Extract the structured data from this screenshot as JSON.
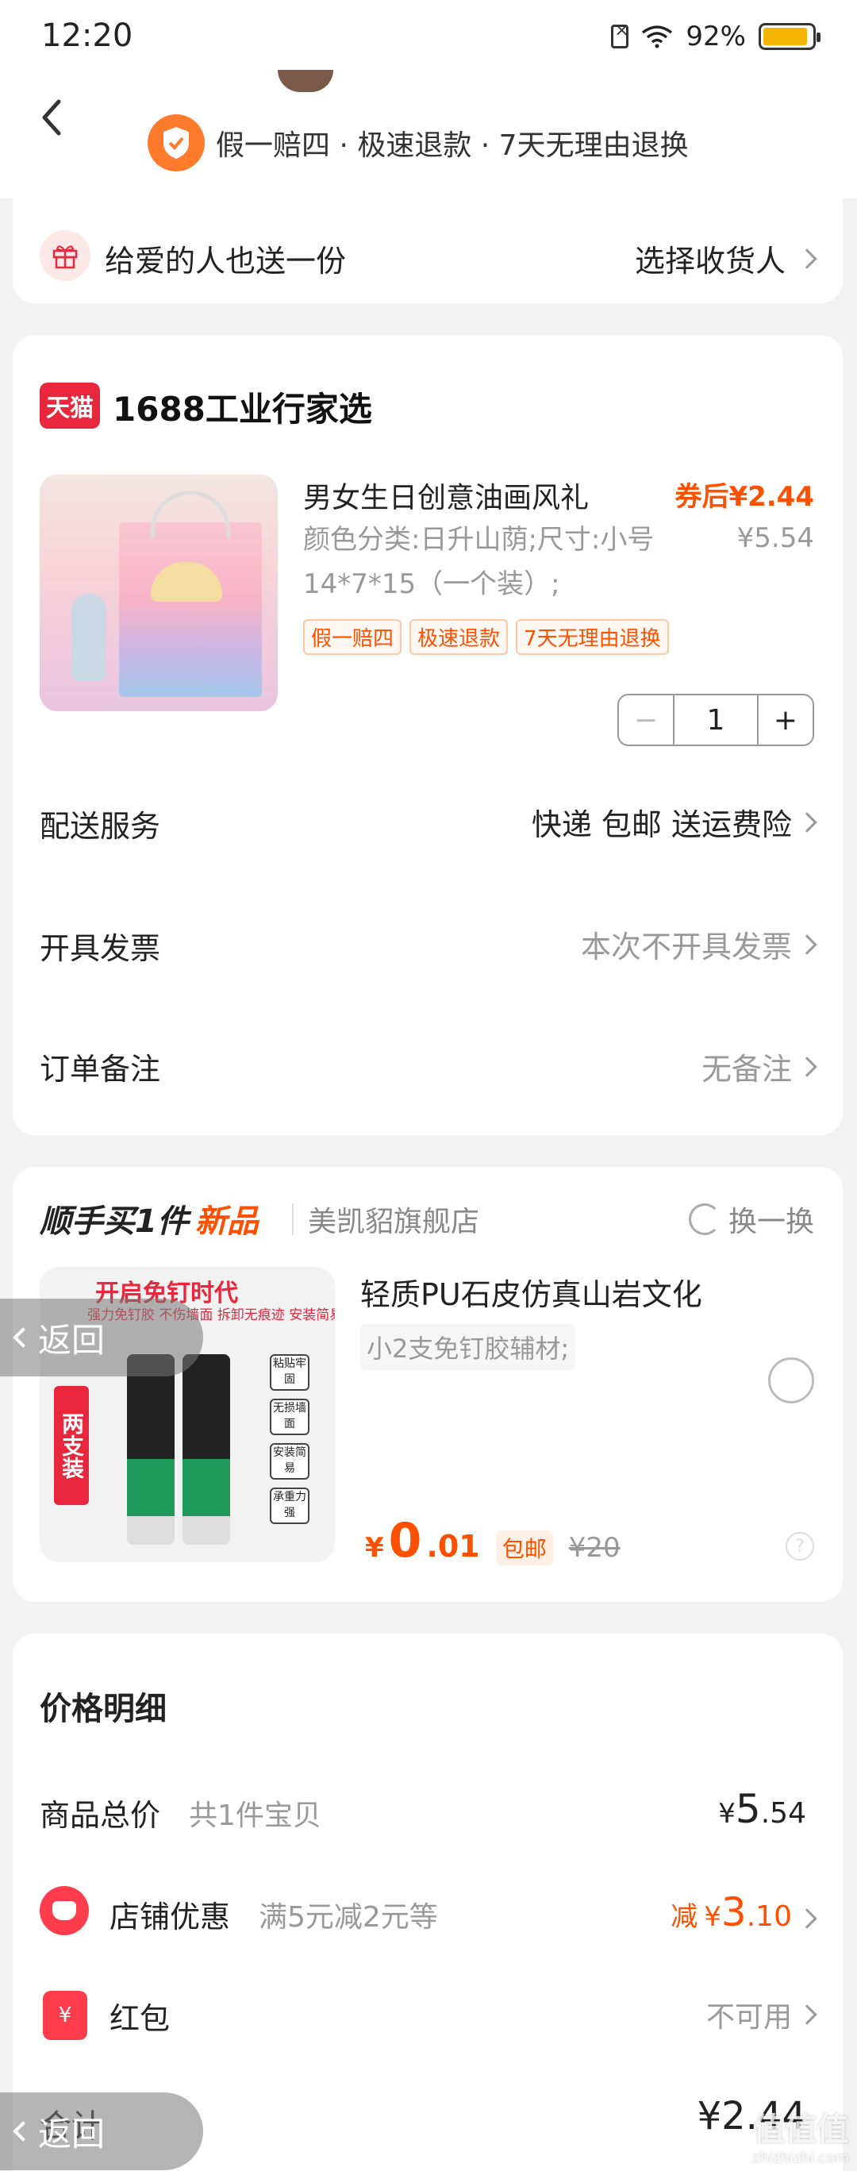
{
  "status_bar": {
    "time": "12:20",
    "battery_percent": "92%",
    "battery_level": 0.92
  },
  "header": {
    "guarantee_text": "假一赔四 · 极速退款 · 7天无理由退换"
  },
  "gift": {
    "label": "给爱的人也送一份",
    "action": "选择收货人"
  },
  "order": {
    "tmall_logo": "天猫",
    "shop_name": "1688工业行家选",
    "product": {
      "title": "男女生日创意油画风礼",
      "price_after_coupon": "券后¥2.44",
      "spec": "颜色分类:日升山荫;尺寸:小号14*7*15（一个装）;",
      "original_price": "¥5.54",
      "tags": [
        "假一赔四",
        "极速退款",
        "7天无理由退换"
      ],
      "quantity": "1",
      "minus": "−",
      "plus": "+"
    },
    "delivery": {
      "label": "配送服务",
      "value": "快递 包邮 送运费险"
    },
    "invoice": {
      "label": "开具发票",
      "value": "本次不开具发票"
    },
    "note": {
      "label": "订单备注",
      "value": "无备注"
    }
  },
  "addon": {
    "title": "顺手买1件",
    "new_label": "新品",
    "shop": "美凯貂旗舰店",
    "swap": "换一换",
    "image_title": "开启免钉时代",
    "image_sub": "强力免钉胶 不伤墙面 拆卸无痕迹 安装简易 承重力强",
    "image_two_pack": "两支装",
    "image_features": [
      "粘贴牢固",
      "无损墙面",
      "安装简易",
      "承重力强"
    ],
    "name": "轻质PU石皮仿真山岩文化",
    "spec": "小2支免钉胶辅材;",
    "price_symbol": "¥",
    "price_int": "0",
    "price_dec": ".01",
    "free_shipping": "包邮",
    "original_price": "¥20",
    "help": "?"
  },
  "price_detail": {
    "title": "价格明细",
    "total_label": "商品总价",
    "total_count": "共1件宝贝",
    "total_symbol": "¥",
    "total_int": "5",
    "total_dec": ".54",
    "store_label": "店铺优惠",
    "store_desc": "满5元减2元等",
    "store_prefix": "减",
    "store_symbol": "¥",
    "store_int": "3",
    "store_dec": ".10",
    "redpack_label": "红包",
    "redpack_icon": "¥",
    "redpack_value": "不可用",
    "sum_label": "合计",
    "sum_value": "¥2.44"
  },
  "floating": {
    "back_label": "返回"
  },
  "watermark": {
    "text": "值值值",
    "url": "zhizhizhi.com"
  },
  "colors": {
    "accent": "#ff5000",
    "tmall_red": "#e8263c",
    "background": "#f2f2f2"
  }
}
